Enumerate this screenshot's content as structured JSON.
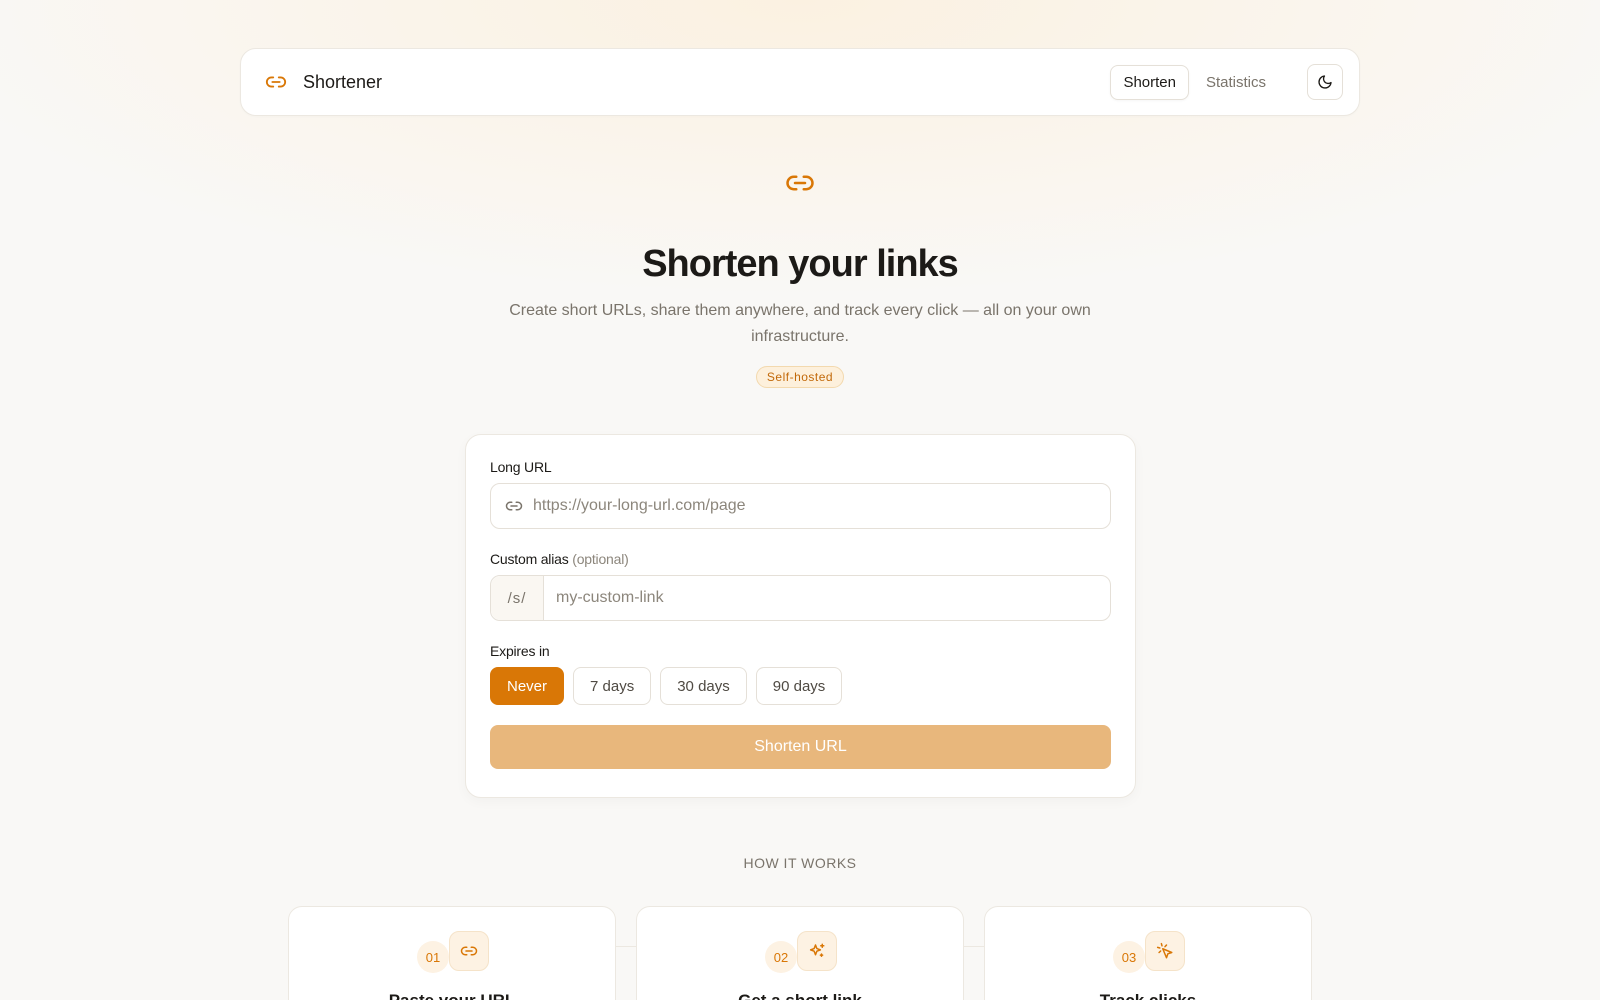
{
  "nav": {
    "brand": "Shortener",
    "tabs": [
      {
        "label": "Shorten",
        "active": true
      },
      {
        "label": "Statistics",
        "active": false
      }
    ],
    "theme_icon": "moon-icon"
  },
  "hero": {
    "icon": "link-icon",
    "title": "Shorten your links",
    "subtitle": "Create short URLs, share them anywhere, and track every click — all on your own infrastructure.",
    "badge": "Self-hosted"
  },
  "form": {
    "long_url": {
      "label": "Long URL",
      "placeholder": "https://your-long-url.com/page",
      "value": ""
    },
    "alias": {
      "label": "Custom alias",
      "optional": "(optional)",
      "prefix": "/s/",
      "placeholder": "my-custom-link",
      "value": ""
    },
    "expires": {
      "label": "Expires in",
      "options": [
        "Never",
        "7 days",
        "30 days",
        "90 days"
      ],
      "selected": "Never"
    },
    "submit_label": "Shorten URL"
  },
  "how": {
    "title": "HOW IT WORKS",
    "steps": [
      {
        "num": "01",
        "icon": "link-icon",
        "title": "Paste your URL"
      },
      {
        "num": "02",
        "icon": "sparkles-icon",
        "title": "Get a short link"
      },
      {
        "num": "03",
        "icon": "cursor-click-icon",
        "title": "Track clicks"
      }
    ]
  },
  "colors": {
    "accent": "#d97706",
    "accent_soft": "#e8b77c",
    "background": "#f9f8f6"
  }
}
